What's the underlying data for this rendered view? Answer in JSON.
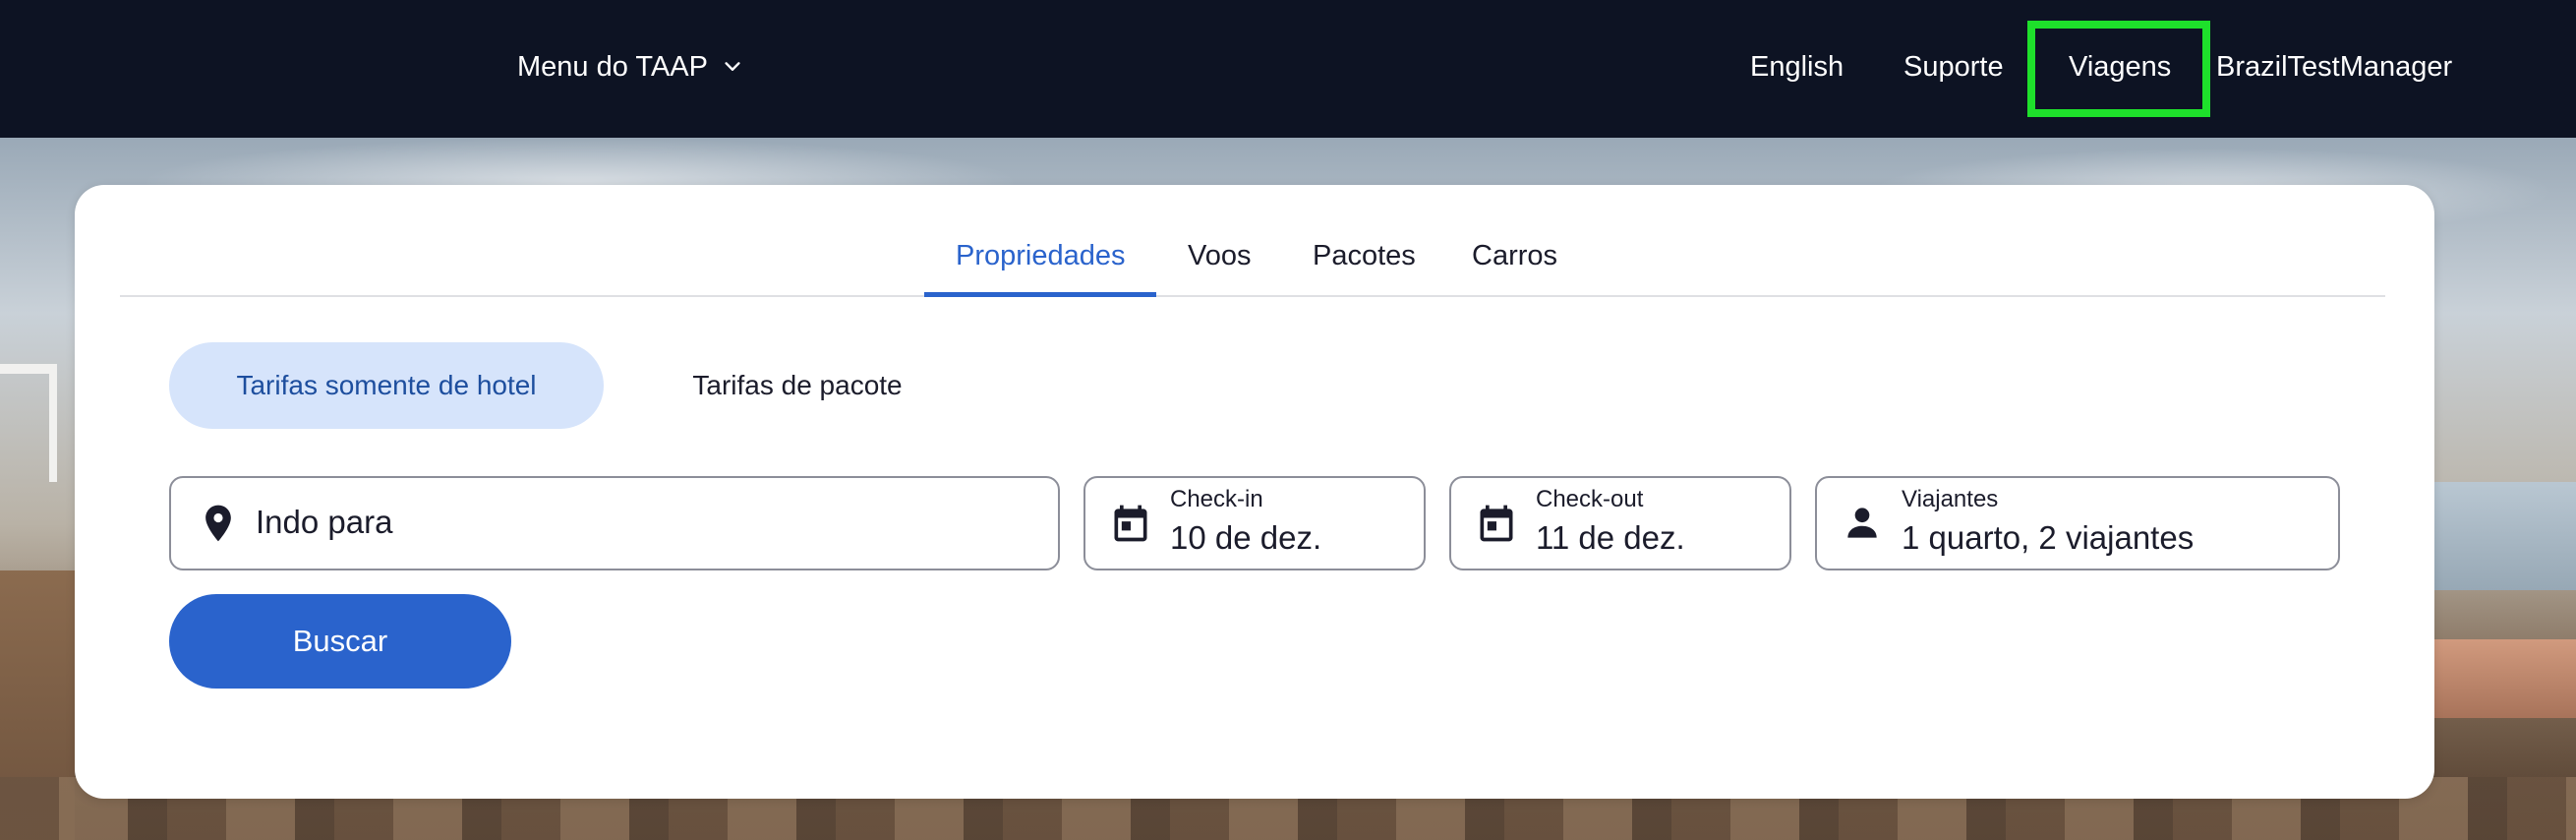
{
  "header": {
    "menu_label": "Menu do TAAP",
    "links": {
      "english": "English",
      "suporte": "Suporte",
      "viagens": "Viagens",
      "user": "BrazilTestManager"
    }
  },
  "search": {
    "tabs": {
      "properties": "Propriedades",
      "flights": "Voos",
      "packages": "Pacotes",
      "cars": "Carros"
    },
    "active_tab": "Propriedades",
    "rate_options": {
      "hotel_only": "Tarifas somente de hotel",
      "package": "Tarifas de pacote"
    },
    "selected_rate": "Tarifas somente de hotel",
    "destination": {
      "placeholder": "Indo para"
    },
    "checkin": {
      "label": "Check-in",
      "value": "10 de dez."
    },
    "checkout": {
      "label": "Check-out",
      "value": "11 de dez."
    },
    "travelers": {
      "label": "Viajantes",
      "value": "1 quarto, 2 viajantes"
    },
    "submit_label": "Buscar"
  },
  "colors": {
    "topbar": "#0d1323",
    "accent": "#2a63cc",
    "pill_selected_bg": "#d6e4fb",
    "highlight": "#1ee02b"
  },
  "icons": {
    "menu_chevron": "chevron-down-icon",
    "destination": "map-pin-icon",
    "checkin": "calendar-icon",
    "checkout": "calendar-icon",
    "travelers": "person-icon"
  }
}
